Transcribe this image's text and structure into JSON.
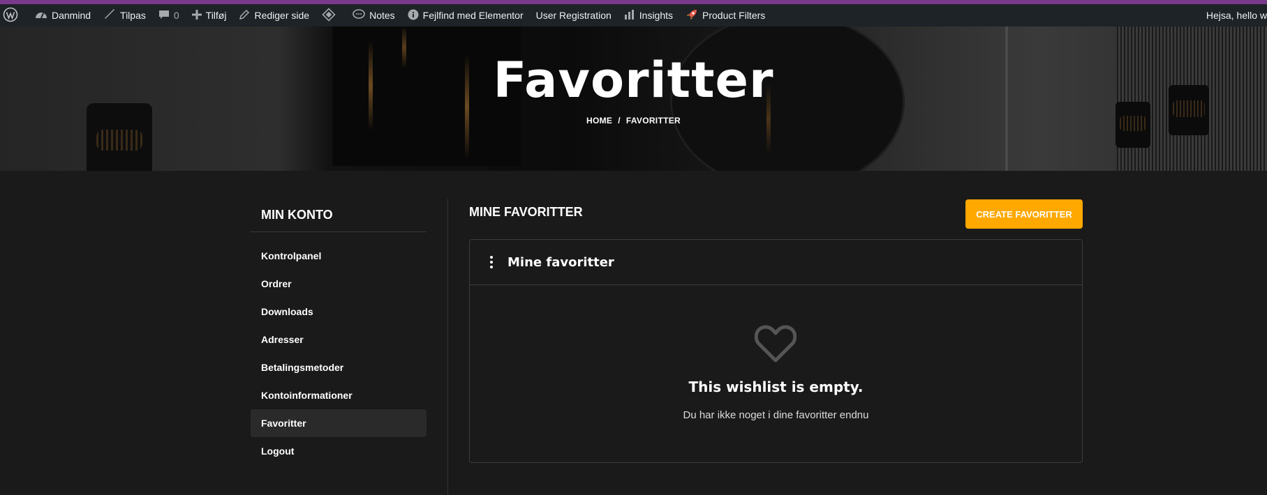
{
  "adminbar": {
    "site_name": "Danmind",
    "customize": "Tilpas",
    "comments_count": "0",
    "new": "Tilføj",
    "edit_page": "Rediger side",
    "notes": "Notes",
    "debug_elementor": "Fejlfind med Elementor",
    "user_registration": "User Registration",
    "insights": "Insights",
    "product_filters": "Product Filters",
    "greeting": "Hejsa, hello w"
  },
  "hero": {
    "title": "Favoritter",
    "breadcrumb": [
      "HOME",
      "FAVORITTER"
    ],
    "separator": "/"
  },
  "sidebar": {
    "title": "MIN KONTO",
    "items": [
      {
        "label": "Kontrolpanel"
      },
      {
        "label": "Ordrer"
      },
      {
        "label": "Downloads"
      },
      {
        "label": "Adresser"
      },
      {
        "label": "Betalingsmetoder"
      },
      {
        "label": "Kontoinformationer"
      },
      {
        "label": "Favoritter"
      },
      {
        "label": "Logout"
      }
    ],
    "active": "Favoritter"
  },
  "main": {
    "title": "MINE FAVORITTER",
    "create_button": "CREATE FAVORITTER",
    "wishlist": {
      "name": "Mine favoritter",
      "empty_title": "This wishlist is empty.",
      "empty_text": "Du har ikke noget i dine favoritter endnu"
    }
  },
  "colors": {
    "accent": "#ffa800",
    "adminbar": "#1d2327",
    "page_bg": "#1a1a1a"
  },
  "icons": [
    "wordpress-icon",
    "dashboard-icon",
    "brush-icon",
    "comment-icon",
    "plus-icon",
    "pencil-icon",
    "diamond-icon",
    "notes-icon",
    "info-icon",
    "bar-chart-icon",
    "rocket-icon",
    "kebab-menu-icon",
    "heart-icon"
  ]
}
